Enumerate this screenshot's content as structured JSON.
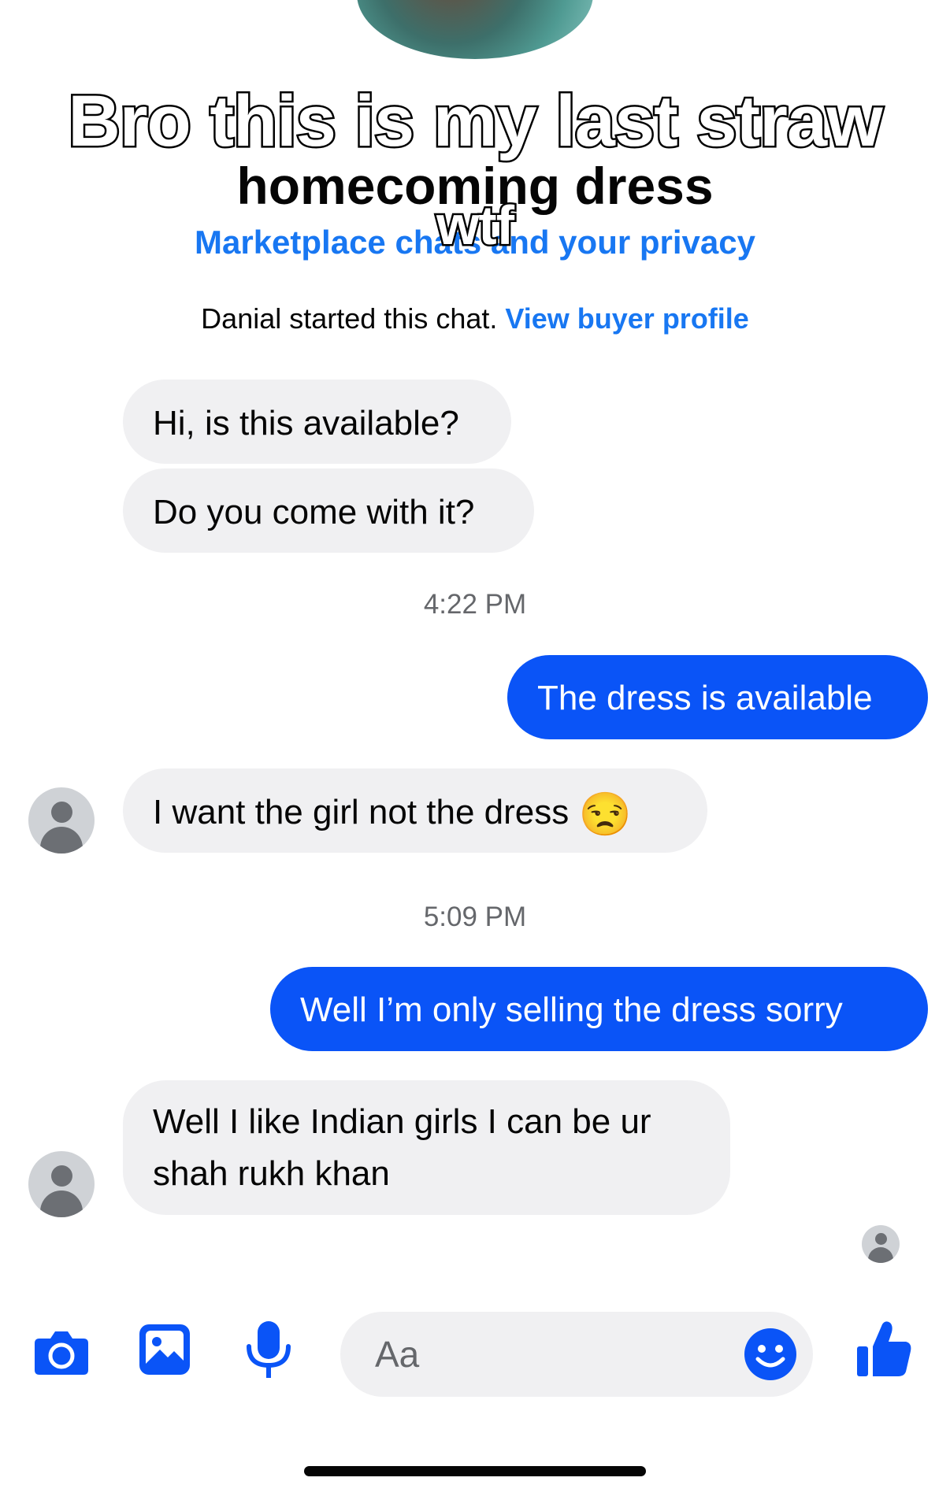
{
  "header": {
    "product_title": "homecoming dress",
    "privacy_link": "Marketplace chats and your privacy",
    "started_text": "Danial started this chat.",
    "buyer_profile_link": "View buyer profile"
  },
  "overlay": {
    "line1": "Bro this is my last straw",
    "line2": "wtf"
  },
  "messages": [
    {
      "side": "incoming",
      "text": "Hi, is this available?"
    },
    {
      "side": "incoming",
      "text": "Do you come with it?"
    },
    {
      "side": "timestamp",
      "text": "4:22 PM"
    },
    {
      "side": "outgoing",
      "text": "The dress is available"
    },
    {
      "side": "incoming",
      "text": "I want the girl not the dress",
      "emoji": "😒"
    },
    {
      "side": "timestamp",
      "text": "5:09 PM"
    },
    {
      "side": "outgoing",
      "text": "Well I’m only selling the dress sorry"
    },
    {
      "side": "incoming",
      "text": "Well I like Indian girls I can be ur shah rukh khan"
    }
  ],
  "composer": {
    "placeholder": "Aa",
    "icons": [
      "camera-icon",
      "gallery-icon",
      "microphone-icon",
      "emoji-icon",
      "like-icon"
    ]
  },
  "colors": {
    "accent": "#0a54f7",
    "link": "#1877f2",
    "incoming_bubble": "#f0f0f2",
    "timestamp": "#65676b"
  }
}
